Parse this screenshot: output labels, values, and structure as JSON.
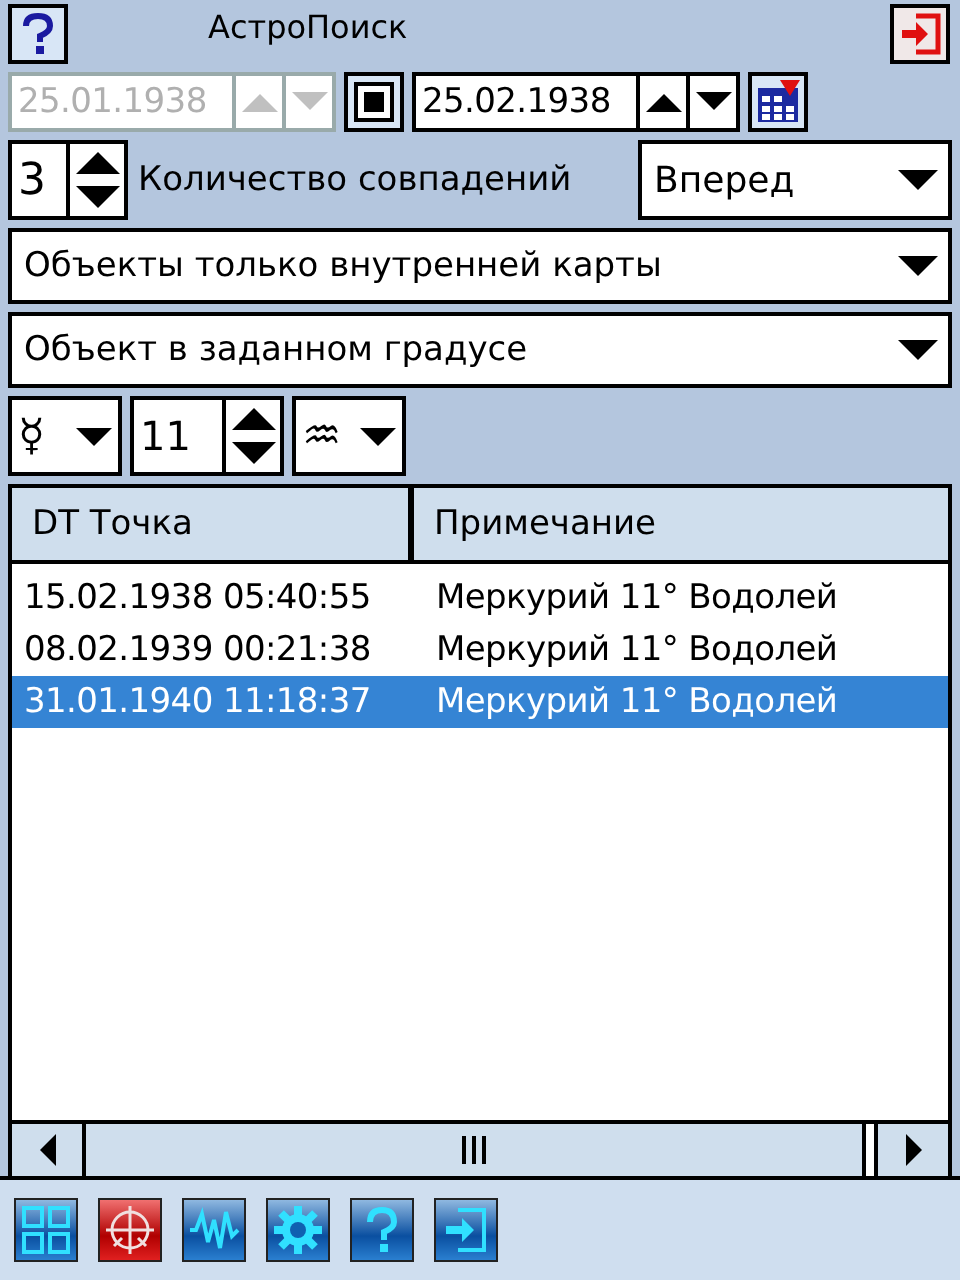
{
  "window": {
    "title": "АстроПоиск"
  },
  "date_range": {
    "start": {
      "value": "25.01.1938",
      "disabled": true
    },
    "end": {
      "value": "25.02.1938",
      "disabled": false
    }
  },
  "match_count": {
    "value": "3",
    "label": "Количество совпадений"
  },
  "direction": {
    "value": "Вперед"
  },
  "object_filter": {
    "value": "Объекты только внутренней карты"
  },
  "search_mode": {
    "value": "Объект в заданном градусе"
  },
  "planet": {
    "value": "☿"
  },
  "degree": {
    "value": "11"
  },
  "sign": {
    "value": "♒"
  },
  "table": {
    "columns": [
      "DT Точка",
      "Примечание"
    ],
    "rows": [
      {
        "cells": [
          "15.02.1938 05:40:55",
          "Меркурий 11° Водолей"
        ],
        "selected": false
      },
      {
        "cells": [
          "08.02.1939 00:21:38",
          "Меркурий 11° Водолей"
        ],
        "selected": false
      },
      {
        "cells": [
          "31.01.1940 11:18:37",
          "Меркурий 11° Водолей"
        ],
        "selected": true
      }
    ]
  }
}
